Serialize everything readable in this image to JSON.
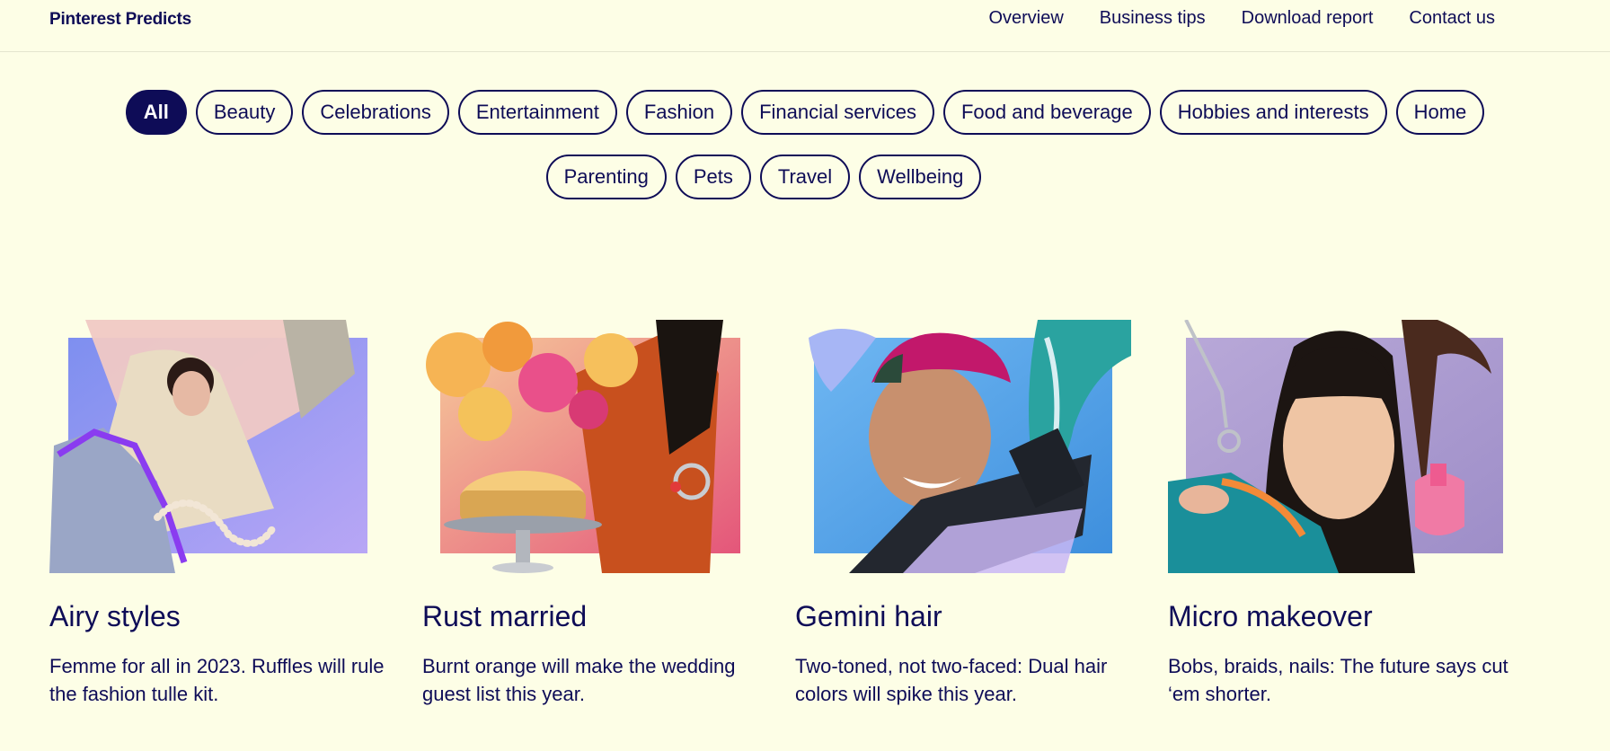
{
  "header": {
    "brand": "Pinterest Predicts",
    "nav": [
      "Overview",
      "Business tips",
      "Download report",
      "Contact us"
    ]
  },
  "filters": {
    "row1": [
      "All",
      "Beauty",
      "Celebrations",
      "Entertainment",
      "Fashion",
      "Financial services",
      "Food and beverage",
      "Hobbies and interests",
      "Home"
    ],
    "row2": [
      "Parenting",
      "Pets",
      "Travel",
      "Wellbeing"
    ],
    "selected": "All"
  },
  "cards": [
    {
      "title": "Airy styles",
      "description": "Femme for all in 2023. Ruffles will rule the fashion tulle kit."
    },
    {
      "title": "Rust married",
      "description": "Burnt orange will make the wedding guest list this year."
    },
    {
      "title": "Gemini hair",
      "description": "Two-toned, not two-faced: Dual hair colors will spike this year."
    },
    {
      "title": "Micro makeover",
      "description": "Bobs, braids, nails: The future says cut ‘em shorter."
    }
  ],
  "colors": {
    "background": "#fdfee6",
    "ink": "#0e0c57"
  }
}
